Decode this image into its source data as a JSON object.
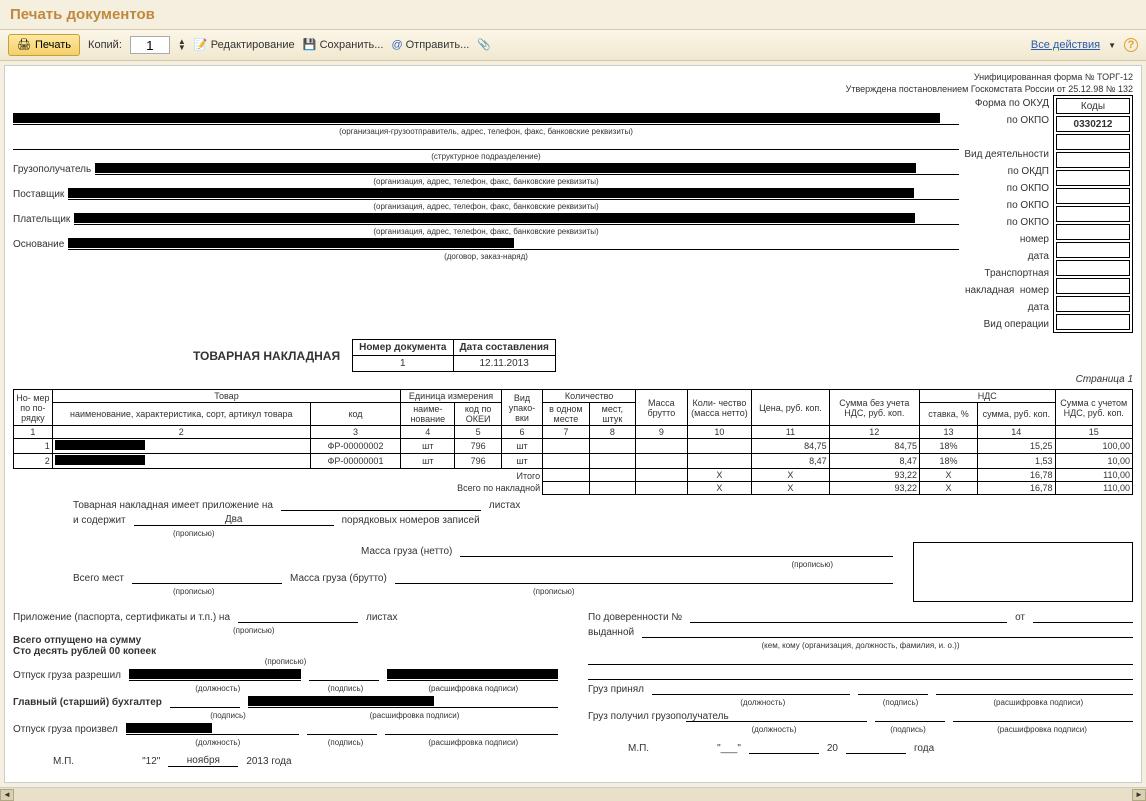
{
  "window": {
    "title": "Печать документов"
  },
  "toolbar": {
    "print": "Печать",
    "copies_label": "Копий:",
    "copies_value": "1",
    "edit": "Редактирование",
    "save": "Сохранить...",
    "send": "Отправить...",
    "all_actions": "Все действия"
  },
  "header": {
    "form_line1": "Унифицированная форма № ТОРГ-12",
    "form_line2": "Утверждена постановлением Госкомстата России от 25.12.98 № 132",
    "codes_title": "Коды",
    "okud_label": "Форма по ОКУД",
    "okud_value": "0330212",
    "okpo_label": "по ОКПО",
    "okdp_label": "Вид деятельности по ОКДП",
    "org_caption": "(организация-грузоотправитель, адрес, телефон, факс, банковские реквизиты)",
    "struct_caption": "(структурное подразделение)",
    "org_caption2": "(организация, адрес, телефон, факс, банковские реквизиты)",
    "consignee": "Грузополучатель",
    "supplier": "Поставщик",
    "payer": "Плательщик",
    "basis": "Основание",
    "basis_caption": "(договор, заказ-наряд)",
    "number_label": "номер",
    "date_label": "дата",
    "trans_label": "Транспортная накладная",
    "optype_label": "Вид операции"
  },
  "docmeta": {
    "title": "ТОВАРНАЯ НАКЛАДНАЯ",
    "num_hdr": "Номер документа",
    "date_hdr": "Дата составления",
    "num": "1",
    "date": "12.11.2013",
    "page": "Страница 1"
  },
  "cols": {
    "num": "Но-\nмер\nпо по-\nрядку",
    "goods": "Товар",
    "name": "наименование, характеристика, сорт, артикул товара",
    "code": "код",
    "unit": "Единица измерения",
    "unit_name": "наиме-\nнование",
    "unit_code": "код по ОКЕИ",
    "pack": "Вид упако-\nвки",
    "qty": "Количество",
    "in_one": "в одном месте",
    "places": "мест, штук",
    "mass": "Масса брутто",
    "qty_net": "Коли-\nчество (масса нетто)",
    "price": "Цена, руб. коп.",
    "sum_novat": "Сумма без учета НДС, руб. коп.",
    "vat": "НДС",
    "rate": "ставка, %",
    "vat_sum": "сумма, руб. коп.",
    "sum_vat": "Сумма с учетом НДС, руб. коп."
  },
  "rows": [
    {
      "n": "1",
      "code": "ФР-00000002",
      "unit": "шт",
      "ucode": "796",
      "pack": "шт",
      "price": "84,75",
      "sum_novat": "84,75",
      "rate": "18%",
      "vat": "15,25",
      "total": "100,00"
    },
    {
      "n": "2",
      "code": "ФР-00000001",
      "unit": "шт",
      "ucode": "796",
      "pack": "шт",
      "price": "8,47",
      "sum_novat": "8,47",
      "rate": "18%",
      "vat": "1,53",
      "total": "10,00"
    }
  ],
  "totals": {
    "itogo": "Итого",
    "total_label": "Всего по накладной",
    "x": "X",
    "sum_novat": "93,22",
    "vat": "16,78",
    "total": "110,00"
  },
  "footer": {
    "attach": "Товарная накладная имеет приложение на",
    "sheets": "листах",
    "contains": "и содержит",
    "two": "Два",
    "records": "порядковых номеров записей",
    "propis": "(прописью)",
    "mass_net": "Масса груза (нетто)",
    "mass_gross": "Масса груза (брутто)",
    "total_places": "Всего мест",
    "apps": "Приложение (паспорта, сертификаты и т.п.) на",
    "released_sum": "Всего отпущено  на сумму",
    "sum_words": "Сто десять рублей 00 копеек",
    "release_auth": "Отпуск груза разрешил",
    "chief_acc": "Главный (старший) бухгалтер",
    "release_done": "Отпуск груза произвел",
    "by_power": "По доверенности №",
    "from": "от",
    "issued": "выданной",
    "issued_cap": "(кем, кому (организация, должность, фамилия, и. о.))",
    "cargo_accepted": "Груз принял",
    "cargo_received": "Груз получил грузополучатель",
    "position": "(должность)",
    "signature": "(подпись)",
    "sig_decode": "(расшифровка подписи)",
    "mp": "М.П.",
    "date_fmt_day": "\"12\"",
    "date_fmt_month": "ноября",
    "date_fmt_year": "2013 года",
    "year_suffix": "20",
    "year_word": "года"
  }
}
